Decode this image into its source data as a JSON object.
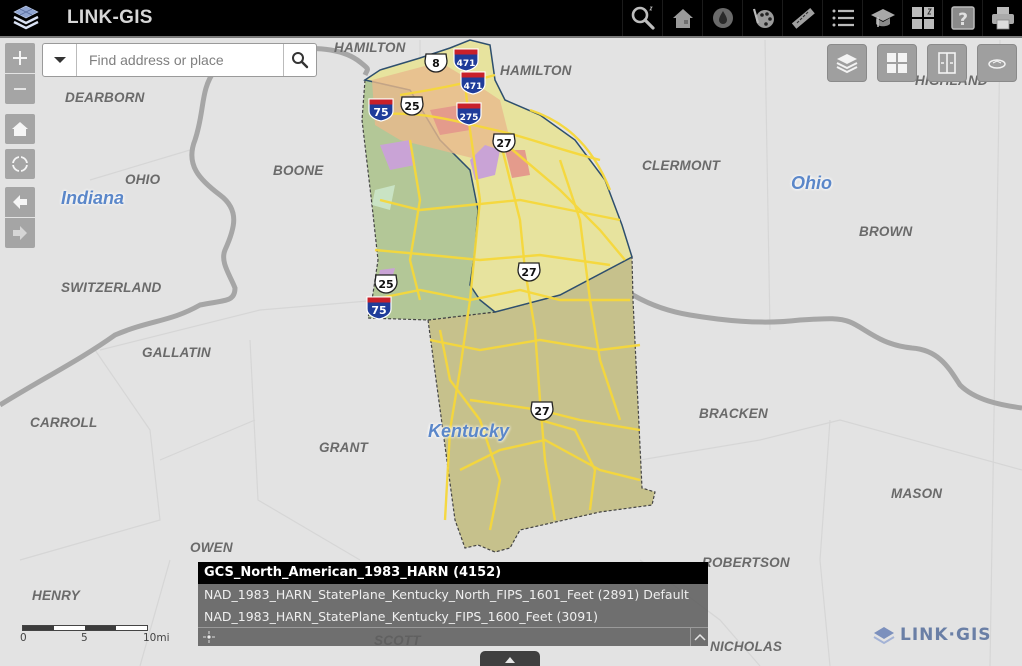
{
  "app": {
    "title": "LINK-GIS",
    "logo_icon": "stacked-layers-icon"
  },
  "toolbar": {
    "tools": [
      {
        "name": "search-tool",
        "icon": "magnifier-icon"
      },
      {
        "name": "home-tool",
        "icon": "house-icon"
      },
      {
        "name": "water-tool",
        "icon": "water-drop-icon"
      },
      {
        "name": "palette-tool",
        "icon": "palette-icon"
      },
      {
        "name": "measure-tool",
        "icon": "ruler-icon"
      },
      {
        "name": "list-tool",
        "icon": "list-icon"
      },
      {
        "name": "learn-tool",
        "icon": "graduation-cap-icon"
      },
      {
        "name": "widgets-tool",
        "icon": "grid-icon"
      },
      {
        "name": "help-tool",
        "icon": "question-icon"
      },
      {
        "name": "print-tool",
        "icon": "printer-icon"
      }
    ]
  },
  "search": {
    "placeholder": "Find address or place",
    "value": ""
  },
  "nav_controls": {
    "zoom_in": "+",
    "zoom_out": "−",
    "home": "home-icon",
    "locate": "locate-icon",
    "back": "arrow-left-icon",
    "forward": "arrow-right-icon"
  },
  "widgets": [
    {
      "name": "layers",
      "icon": "layers-icon"
    },
    {
      "name": "basemap-gallery",
      "icon": "grid-icon"
    },
    {
      "name": "swipe",
      "icon": "swipe-icon"
    },
    {
      "name": "overview",
      "icon": "overview-icon"
    }
  ],
  "map": {
    "state_labels": [
      {
        "text": "Indiana"
      },
      {
        "text": "Ohio"
      },
      {
        "text": "Kentucky"
      }
    ],
    "county_labels": [
      {
        "text": "HAMILTON"
      },
      {
        "text": "HAMILTON"
      },
      {
        "text": "DEARBORN"
      },
      {
        "text": "HIGHLAND"
      },
      {
        "text": "OHIO"
      },
      {
        "text": "BOONE"
      },
      {
        "text": "CLERMONT"
      },
      {
        "text": "BROWN"
      },
      {
        "text": "SWITZERLAND"
      },
      {
        "text": "GALLATIN"
      },
      {
        "text": "CARROLL"
      },
      {
        "text": "GRANT"
      },
      {
        "text": "BRACKEN"
      },
      {
        "text": "MASON"
      },
      {
        "text": "OWEN"
      },
      {
        "text": "ROBERTSON"
      },
      {
        "text": "HENRY"
      },
      {
        "text": "SCOTT"
      },
      {
        "text": "NICHOLAS"
      }
    ],
    "route_shields": [
      {
        "type": "interstate",
        "number": "471"
      },
      {
        "type": "interstate",
        "number": "471"
      },
      {
        "type": "us",
        "number": "8"
      },
      {
        "type": "interstate",
        "number": "75"
      },
      {
        "type": "us",
        "number": "25"
      },
      {
        "type": "interstate",
        "number": "275"
      },
      {
        "type": "us",
        "number": "27"
      },
      {
        "type": "us",
        "number": "27"
      },
      {
        "type": "us",
        "number": "25"
      },
      {
        "type": "interstate",
        "number": "75"
      },
      {
        "type": "us",
        "number": "27"
      }
    ],
    "colors": {
      "background": "#e3e3e3",
      "river": "#a8a8a8",
      "road": "#f5d63a",
      "county_north": "#e8e4a0",
      "county_west": "#b5c99a",
      "county_south": "#c4c08a"
    }
  },
  "coordinate_systems": {
    "items": [
      {
        "label": "GCS_North_American_1983_HARN (4152)",
        "selected": true
      },
      {
        "label": "NAD_1983_HARN_StatePlane_Kentucky_North_FIPS_1601_Feet  (2891) Default",
        "selected": false
      },
      {
        "label": "NAD_1983_HARN_StatePlane_Kentucky_FIPS_1600_Feet  (3091)",
        "selected": false
      }
    ]
  },
  "scalebar": {
    "labels": [
      "0",
      "5",
      "10mi"
    ]
  },
  "watermark": {
    "text": "LINK·GIS"
  }
}
